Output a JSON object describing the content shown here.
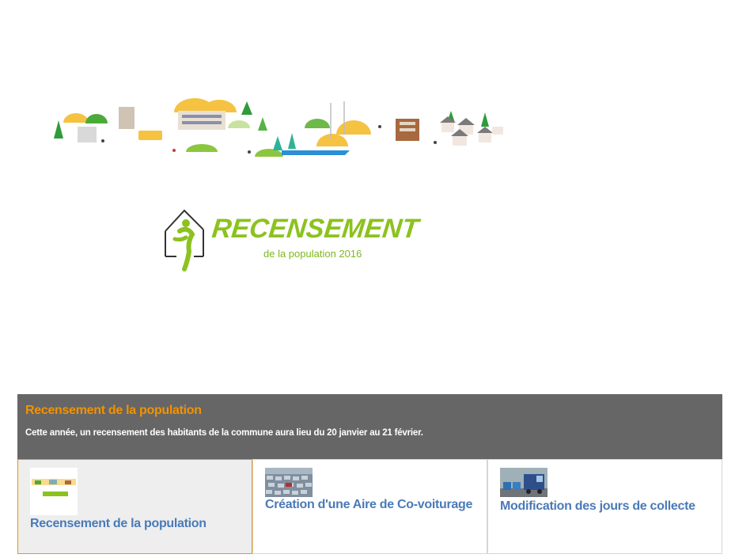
{
  "logo": {
    "title": "RECENSEMENT",
    "subtitle": "de la population 2016"
  },
  "slider": {
    "title": "Recensement de la population",
    "description": "Cette année, un recensement des habitants de la commune aura lieu du 20 janvier au 21 février.",
    "accent_color": "#f39200",
    "link_color": "#4a7ab7",
    "items": [
      {
        "label": "Recensement de la population",
        "image": "recensement-thumbnail",
        "active": true
      },
      {
        "label": "Création d'une Aire de Co-voiturage",
        "image": "car-park-thumbnail",
        "active": false
      },
      {
        "label": "Modification des jours de collecte",
        "image": "garbage-truck-thumbnail",
        "active": false
      }
    ]
  }
}
